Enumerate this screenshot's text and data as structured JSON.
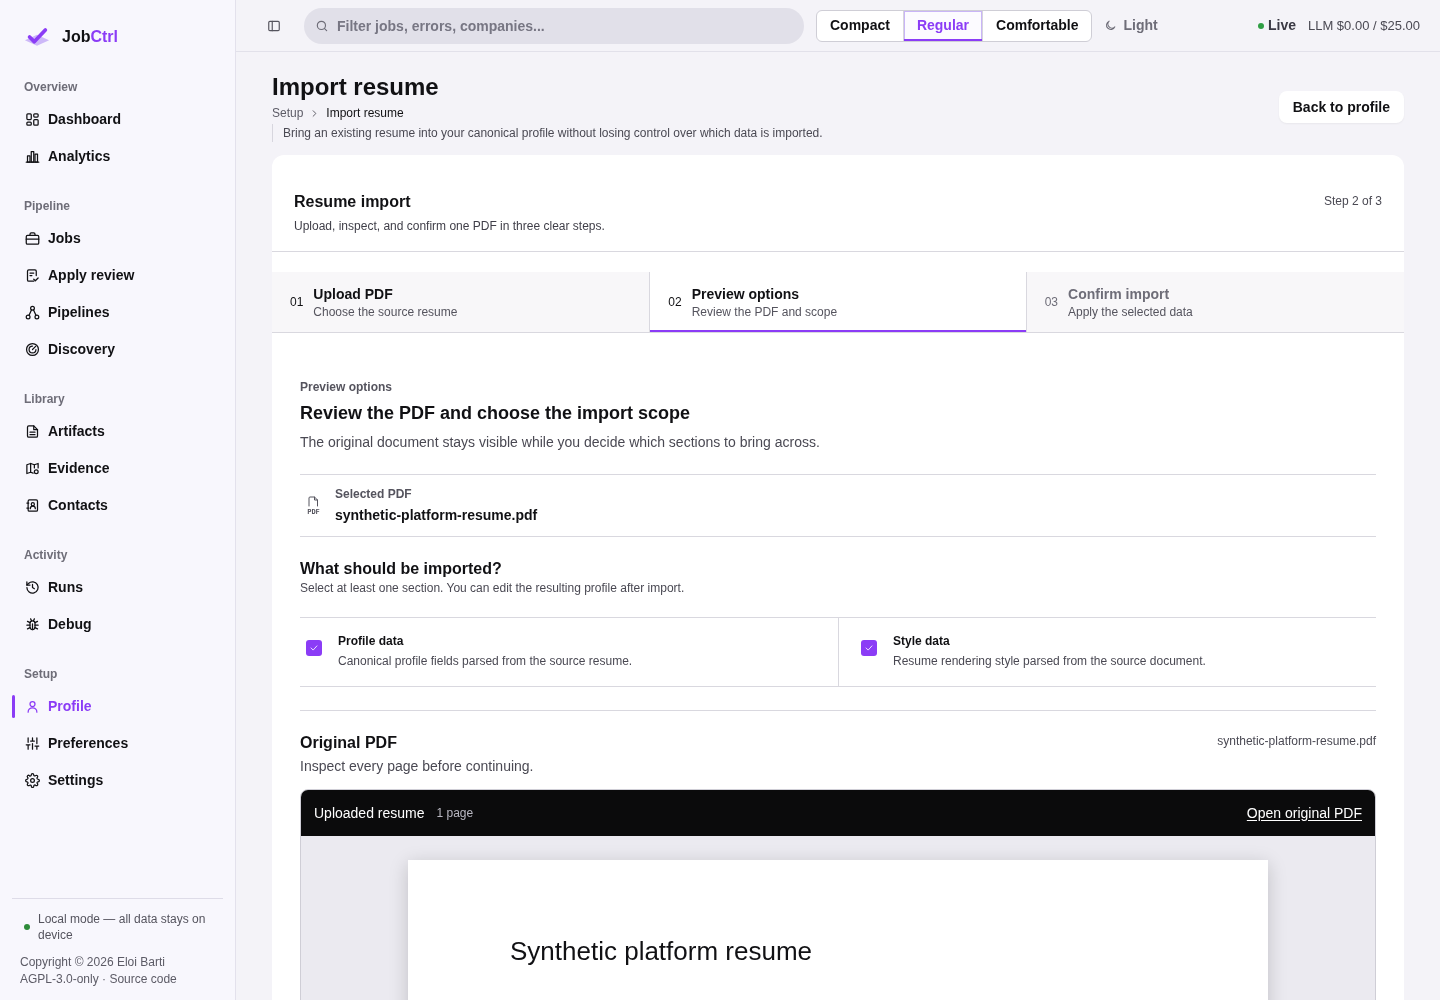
{
  "sidebar": {
    "brand": {
      "name": "Job",
      "accent": "Ctrl"
    },
    "sections": [
      {
        "heading": "Overview",
        "items": [
          {
            "label": "Dashboard",
            "selected": false
          },
          {
            "label": "Analytics",
            "selected": false
          }
        ]
      },
      {
        "heading": "Pipeline",
        "items": [
          {
            "label": "Jobs",
            "selected": false
          },
          {
            "label": "Apply review",
            "selected": false
          },
          {
            "label": "Pipelines",
            "selected": false
          },
          {
            "label": "Discovery",
            "selected": false
          }
        ]
      },
      {
        "heading": "Library",
        "items": [
          {
            "label": "Artifacts",
            "selected": false
          },
          {
            "label": "Evidence",
            "selected": false
          },
          {
            "label": "Contacts",
            "selected": false
          }
        ]
      },
      {
        "heading": "Activity",
        "items": [
          {
            "label": "Runs",
            "selected": false
          },
          {
            "label": "Debug",
            "selected": false
          }
        ]
      },
      {
        "heading": "Setup",
        "items": [
          {
            "label": "Profile",
            "selected": true
          },
          {
            "label": "Preferences",
            "selected": false
          },
          {
            "label": "Settings",
            "selected": false
          }
        ]
      }
    ],
    "footer": {
      "mode": {
        "text": "Local mode — all data stays on device",
        "color": "#2e8b3a"
      },
      "copyright": "Copyright © 2026 Eloi Barti",
      "license": "AGPL-3.0-only ·",
      "source_link": "Source code"
    }
  },
  "topbar": {
    "search": {
      "placeholder": "Filter jobs, errors, companies..."
    },
    "density": [
      {
        "label": "Compact",
        "selected": false
      },
      {
        "label": "Regular",
        "selected": true
      },
      {
        "label": "Comfortable",
        "selected": false
      }
    ],
    "theme": {
      "label": "Light"
    },
    "live": {
      "label": "Live",
      "color": "#2f9e44"
    },
    "usage": "LLM $0.00 / $25.00"
  },
  "page": {
    "title": "Import resume",
    "breadcrumb": [
      {
        "label": "Setup",
        "current": false
      },
      {
        "label": "Import resume",
        "current": true
      }
    ],
    "description": "Bring an existing resume into your canonical profile without losing control over which data is imported.",
    "back_button": "Back to profile"
  },
  "import_card": {
    "title": "Resume import",
    "subtitle": "Upload, inspect, and confirm one PDF in three clear steps.",
    "step_counter": "Step 2 of 3",
    "steps": [
      {
        "number": "01",
        "title": "Upload PDF",
        "subtitle": "Choose the source resume",
        "selected": false,
        "disabled": false
      },
      {
        "number": "02",
        "title": "Preview options",
        "subtitle": "Review the PDF and scope",
        "selected": true,
        "disabled": false
      },
      {
        "number": "03",
        "title": "Confirm import",
        "subtitle": "Apply the selected data",
        "selected": false,
        "disabled": true
      }
    ],
    "preview": {
      "eyebrow": "Preview options",
      "heading": "Review the PDF and choose the import scope",
      "description": "The original document stays visible while you decide which sections to bring across.",
      "selected_pdf": {
        "label": "Selected PDF",
        "icon_text": "PDF",
        "filename": "synthetic-platform-resume.pdf"
      },
      "scope": {
        "heading": "What should be imported?",
        "help": "Select at least one section. You can edit the resulting profile after import.",
        "options": [
          {
            "title": "Profile data",
            "description": "Canonical profile fields parsed from the source resume.",
            "checked": true
          },
          {
            "title": "Style data",
            "description": "Resume rendering style parsed from the source document.",
            "checked": true
          }
        ]
      },
      "original_pdf": {
        "heading": "Original PDF",
        "description": "Inspect every page before continuing.",
        "filename": "synthetic-platform-resume.pdf",
        "viewer": {
          "title": "Uploaded resume",
          "page_count": "1 page",
          "open_link": "Open original PDF",
          "document_title": "Synthetic platform resume"
        }
      }
    }
  }
}
